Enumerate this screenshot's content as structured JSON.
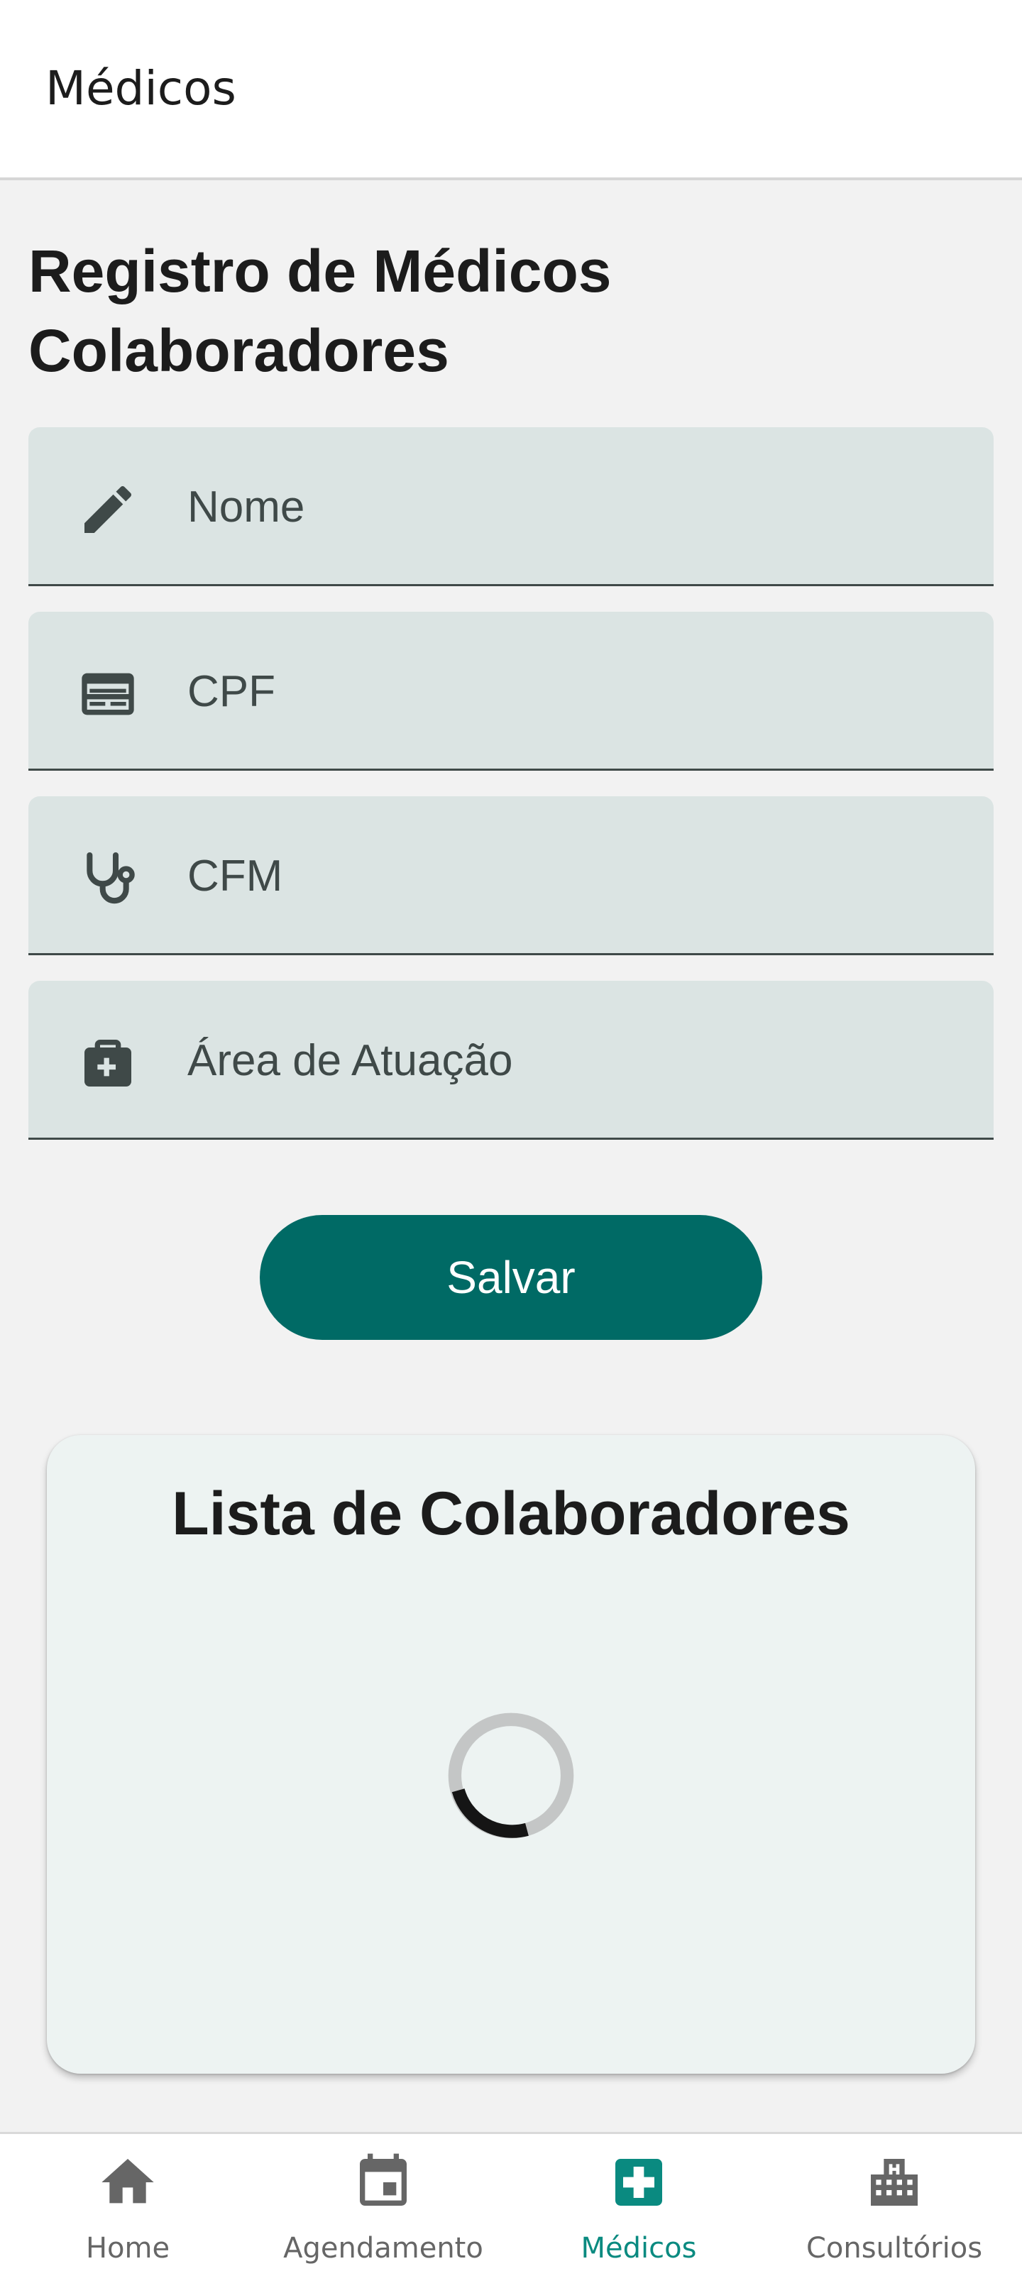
{
  "app_bar": {
    "title": "Médicos"
  },
  "form": {
    "heading": "Registro de Médicos Colaboradores",
    "fields": [
      {
        "icon": "pencil-icon",
        "placeholder": "Nome"
      },
      {
        "icon": "id-card-icon",
        "placeholder": "CPF"
      },
      {
        "icon": "stethoscope-icon",
        "placeholder": "CFM"
      },
      {
        "icon": "medical-bag-icon",
        "placeholder": "Área de Atuação"
      }
    ],
    "save_label": "Salvar"
  },
  "list": {
    "title": "Lista de Colaboradores",
    "loading": true
  },
  "bottom_nav": {
    "items": [
      {
        "icon": "home-icon",
        "label": "Home",
        "active": false
      },
      {
        "icon": "calendar-icon",
        "label": "Agendamento",
        "active": false
      },
      {
        "icon": "medical-cross-icon",
        "label": "Médicos",
        "active": true
      },
      {
        "icon": "hospital-building-icon",
        "label": "Consultórios",
        "active": false
      }
    ]
  },
  "colors": {
    "primary": "#006a65",
    "active_nav": "#0a8a80",
    "field_background": "#dbe4e3",
    "card_background": "#edf3f2",
    "page_background": "#f2f2f2"
  }
}
